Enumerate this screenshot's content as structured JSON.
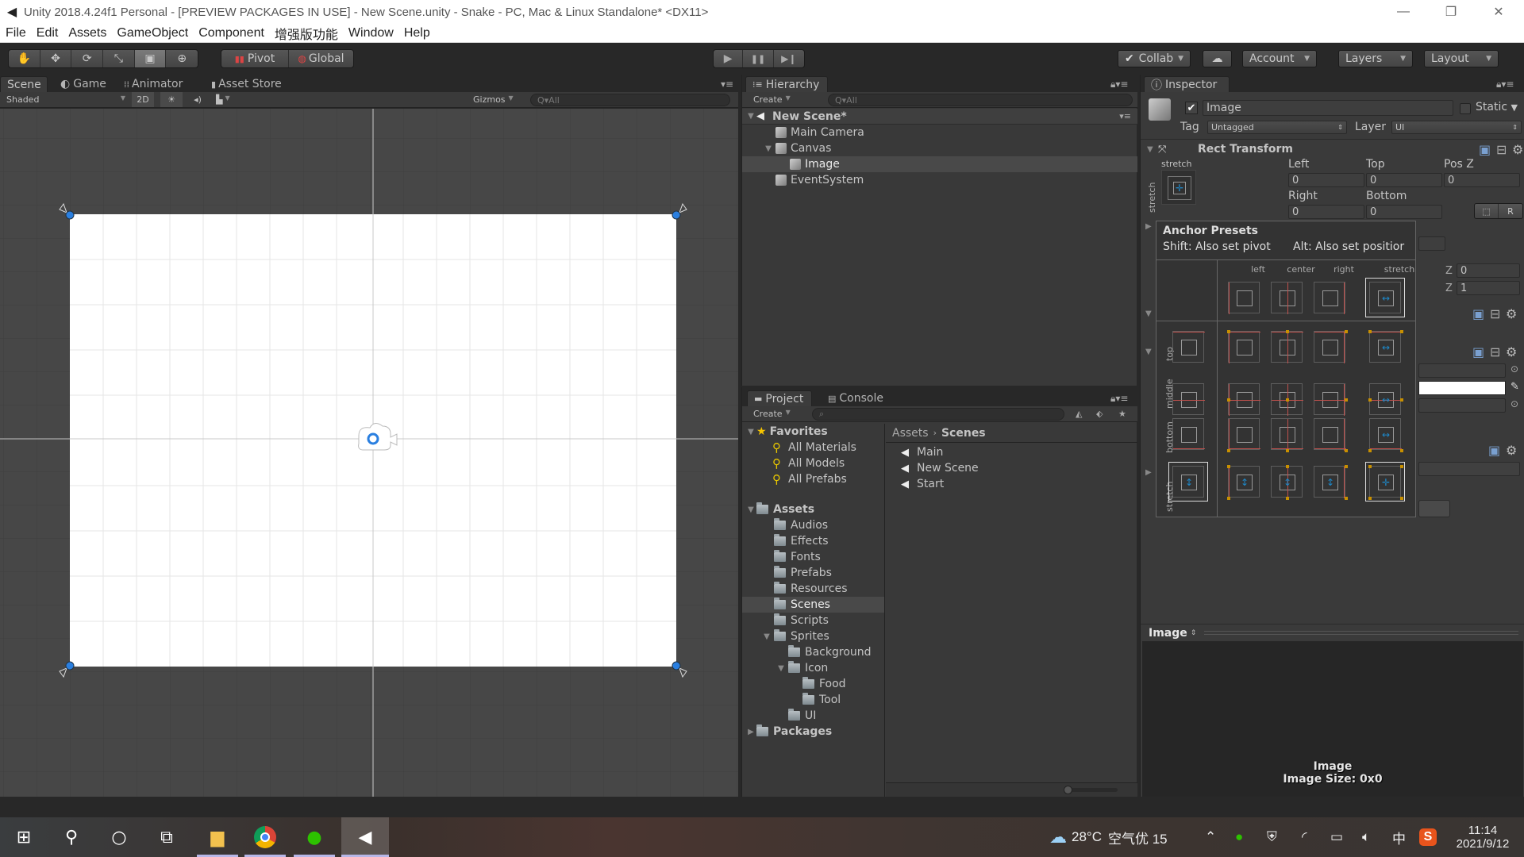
{
  "window": {
    "title": "Unity 2018.4.24f1 Personal - [PREVIEW PACKAGES IN USE] - New Scene.unity - Snake - PC, Mac & Linux Standalone* <DX11>",
    "controls": {
      "minimize": "—",
      "maximize": "❐",
      "close": "✕"
    }
  },
  "menu": [
    "File",
    "Edit",
    "Assets",
    "GameObject",
    "Component",
    "增强版功能",
    "Window",
    "Help"
  ],
  "toolbar": {
    "tools": [
      {
        "name": "hand-tool",
        "glyph": "✋",
        "active": false
      },
      {
        "name": "move-tool",
        "glyph": "✥",
        "active": false
      },
      {
        "name": "rotate-tool",
        "glyph": "⟳",
        "active": false
      },
      {
        "name": "scale-tool",
        "glyph": "⤡",
        "active": false
      },
      {
        "name": "rect-tool",
        "glyph": "▣",
        "active": true
      },
      {
        "name": "transform-tool",
        "glyph": "⊕",
        "active": false
      }
    ],
    "pivot_label": "Pivot",
    "global_label": "Global",
    "play": {
      "play": "▶",
      "pause": "❚❚",
      "step": "▶❙"
    },
    "collab_label": "Collab",
    "cloud_glyph": "☁",
    "account_label": "Account",
    "layers_label": "Layers",
    "layout_label": "Layout"
  },
  "scene_panel": {
    "tabs": [
      {
        "label": "Scene",
        "active": true
      },
      {
        "label": "Game",
        "active": false
      },
      {
        "label": "Animator",
        "active": false
      },
      {
        "label": "Asset Store",
        "active": false
      }
    ],
    "shading_mode": "Shaded",
    "mode_2d": "2D",
    "gizmos_label": "Gizmos",
    "search_placeholder": "Q▾All"
  },
  "hierarchy": {
    "tab_label": "Hierarchy",
    "create_label": "Create",
    "search_placeholder": "Q▾All",
    "scene_name": "New Scene*",
    "items": [
      {
        "label": "Main Camera",
        "depth": 1,
        "expanded": null,
        "selected": false
      },
      {
        "label": "Canvas",
        "depth": 1,
        "expanded": true,
        "selected": false
      },
      {
        "label": "Image",
        "depth": 2,
        "expanded": null,
        "selected": true
      },
      {
        "label": "EventSystem",
        "depth": 1,
        "expanded": null,
        "selected": false
      }
    ]
  },
  "project": {
    "tabs": [
      {
        "label": "Project",
        "active": true
      },
      {
        "label": "Console",
        "active": false
      }
    ],
    "create_label": "Create",
    "favorites_label": "Favorites",
    "favorites": [
      "All Materials",
      "All Models",
      "All Prefabs"
    ],
    "assets_label": "Assets",
    "folders": [
      {
        "label": "Audios",
        "depth": 1
      },
      {
        "label": "Effects",
        "depth": 1
      },
      {
        "label": "Fonts",
        "depth": 1
      },
      {
        "label": "Prefabs",
        "depth": 1
      },
      {
        "label": "Resources",
        "depth": 1
      },
      {
        "label": "Scenes",
        "depth": 1,
        "selected": true
      },
      {
        "label": "Scripts",
        "depth": 1
      },
      {
        "label": "Sprites",
        "depth": 1,
        "expanded": true
      },
      {
        "label": "Background",
        "depth": 2
      },
      {
        "label": "Icon",
        "depth": 2,
        "expanded": true
      },
      {
        "label": "Food",
        "depth": 3
      },
      {
        "label": "Tool",
        "depth": 3
      },
      {
        "label": "UI",
        "depth": 2
      }
    ],
    "packages_label": "Packages",
    "breadcrumb": [
      "Assets",
      "Scenes"
    ],
    "files": [
      "Main",
      "New Scene",
      "Start"
    ]
  },
  "inspector": {
    "tab_label": "Inspector",
    "object_name": "Image",
    "active": true,
    "static_label": "Static",
    "tag_label": "Tag",
    "tag_value": "Untagged",
    "layer_label": "Layer",
    "layer_value": "UI",
    "rect_transform": {
      "title": "Rect Transform",
      "anchor_h": "stretch",
      "anchor_v": "stretch",
      "left_label": "Left",
      "left": "0",
      "top_label": "Top",
      "top": "0",
      "posz_label": "Pos Z",
      "posz": "0",
      "right_label": "Right",
      "right": "0",
      "bottom_label": "Bottom",
      "bottom": "0",
      "blueprint_btn": "⬚",
      "raw_btn": "R",
      "z_label": "Z",
      "z0": "0",
      "z1": "1"
    },
    "preview": {
      "title": "Image",
      "caption_name": "Image",
      "caption_size": "Image Size: 0x0"
    }
  },
  "anchor_presets": {
    "title": "Anchor Presets",
    "shift_hint": "Shift: Also set pivot",
    "alt_hint": "Alt: Also set positior",
    "columns": [
      "left",
      "center",
      "right",
      "stretch"
    ],
    "rows": [
      "top",
      "middle",
      "bottom",
      "stretch"
    ],
    "selected": "stretch-stretch"
  },
  "taskbar": {
    "weather": "28°C",
    "air": "空气优 15",
    "ime": "中",
    "time": "11:14",
    "date": "2021/9/12",
    "apps": [
      "start",
      "search",
      "cortana",
      "task-view",
      "file-explorer",
      "chrome",
      "wechat",
      "unity"
    ]
  },
  "colors": {
    "accent_blue": "#1e88c8",
    "anchor_red": "#c0504d",
    "anchor_gold": "#c89000"
  }
}
